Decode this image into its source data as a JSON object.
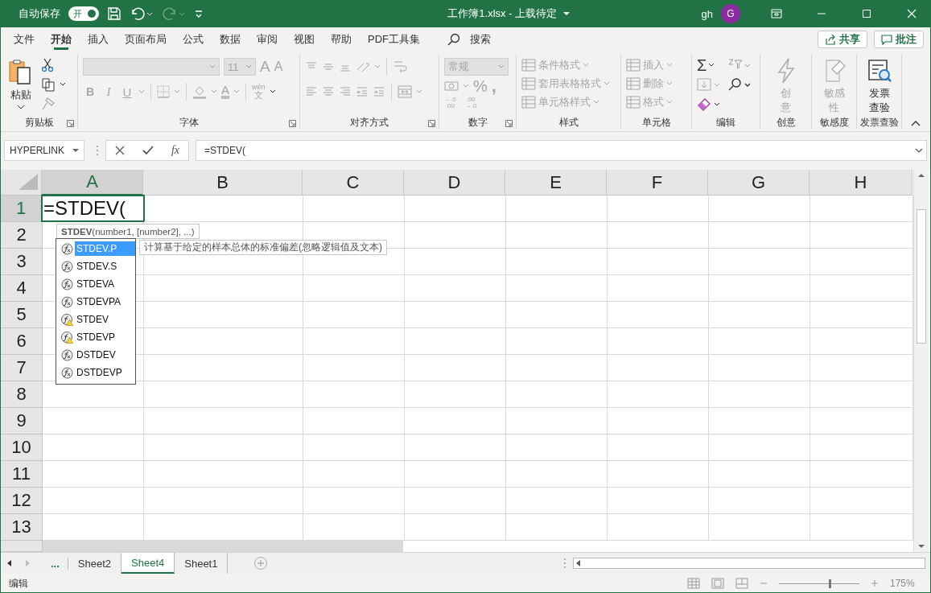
{
  "title_bar": {
    "autosave_label": "自动保存",
    "autosave": {
      "label": "开",
      "on": true
    },
    "title": "工作簿1.xlsx - 上载待定",
    "user": "gh",
    "avatar": "G"
  },
  "menu_tabs": [
    {
      "label": "文件",
      "selected": false
    },
    {
      "label": "开始",
      "selected": true
    },
    {
      "label": "插入",
      "selected": false
    },
    {
      "label": "页面布局",
      "selected": false
    },
    {
      "label": "公式",
      "selected": false
    },
    {
      "label": "数据",
      "selected": false
    },
    {
      "label": "审阅",
      "selected": false
    },
    {
      "label": "视图",
      "selected": false
    },
    {
      "label": "帮助",
      "selected": false
    },
    {
      "label": "PDF工具集",
      "selected": false
    }
  ],
  "search": {
    "label": "搜索"
  },
  "share_button": "共享",
  "comments_button": "批注",
  "ribbon": [
    {
      "kind": "clipboard",
      "label": "剪贴板",
      "paste": "粘贴",
      "launcher": true
    },
    {
      "kind": "font",
      "label": "字体",
      "disabled": true,
      "size": "11",
      "grow": "A",
      "shrink": "A",
      "bold": "B",
      "italic": "I",
      "underline": "U",
      "font_color": "A",
      "phonetic_top": "wén",
      "phonetic_bottom": "文",
      "launcher": true
    },
    {
      "kind": "alignment",
      "label": "对齐方式",
      "disabled": true,
      "launcher": true
    },
    {
      "kind": "number",
      "label": "数字",
      "disabled": true,
      "format": "常规",
      "percent": "%",
      "comma": ",",
      "inc_decimal": [
        "←.0",
        ".00"
      ],
      "dec_decimal": [
        ".00",
        "→.0"
      ],
      "launcher": true
    },
    {
      "kind": "styles",
      "label": "样式",
      "disabled": true,
      "items": [
        "条件格式",
        "套用表格格式",
        "单元格样式"
      ]
    },
    {
      "kind": "cells",
      "label": "单元格",
      "disabled": true,
      "items": [
        "插入",
        "删除",
        "格式"
      ]
    },
    {
      "kind": "editing",
      "label": "编辑",
      "sum": "Σ"
    },
    {
      "kind": "creativity",
      "label": "创意",
      "button": "创意",
      "disabled": true
    },
    {
      "kind": "sensitivity",
      "label": "敏感度",
      "button": "敏感性",
      "disabled": true
    },
    {
      "kind": "invoice",
      "label": "发票查验",
      "button": "发票查验",
      "disabled": false
    }
  ],
  "formula_bar": {
    "name_box": "HYPERLINK",
    "insert_function": "fx",
    "formula": "=STDEV("
  },
  "sheet": {
    "columns": [
      {
        "label": "A",
        "selected": true
      },
      {
        "label": "B",
        "selected": false
      },
      {
        "label": "C",
        "selected": false
      },
      {
        "label": "D",
        "selected": false
      },
      {
        "label": "E",
        "selected": false
      },
      {
        "label": "F",
        "selected": false
      },
      {
        "label": "G",
        "selected": false
      },
      {
        "label": "H",
        "selected": false
      }
    ],
    "rows": [
      {
        "label": "1",
        "selected": true
      },
      {
        "label": "2",
        "selected": false
      },
      {
        "label": "3",
        "selected": false
      },
      {
        "label": "4",
        "selected": false
      },
      {
        "label": "5",
        "selected": false
      },
      {
        "label": "6",
        "selected": false
      },
      {
        "label": "7",
        "selected": false
      },
      {
        "label": "8",
        "selected": false
      },
      {
        "label": "9",
        "selected": false
      },
      {
        "label": "10",
        "selected": false
      },
      {
        "label": "11",
        "selected": false
      },
      {
        "label": "12",
        "selected": false
      },
      {
        "label": "13",
        "selected": false
      }
    ],
    "active_cell": "=STDEV(",
    "arg_tooltip": "**STDEV**(number1, [number2], ...)",
    "autocomplete": [
      {
        "name": "STDEV.P",
        "kind": "function",
        "selected": true
      },
      {
        "name": "STDEV.S",
        "kind": "function",
        "selected": false
      },
      {
        "name": "STDEVA",
        "kind": "function",
        "selected": false
      },
      {
        "name": "STDEVPA",
        "kind": "function",
        "selected": false
      },
      {
        "name": "STDEV",
        "kind": "compat",
        "selected": false
      },
      {
        "name": "STDEVP",
        "kind": "compat",
        "selected": false
      },
      {
        "name": "DSTDEV",
        "kind": "function",
        "selected": false
      },
      {
        "name": "DSTDEVP",
        "kind": "function",
        "selected": false
      }
    ],
    "description": "计算基于给定的样本总体的标准偏差(忽略逻辑值及文本)"
  },
  "sheet_tabs": {
    "more": "...",
    "tabs": [
      {
        "label": "Sheet2",
        "selected": false
      },
      {
        "label": "Sheet4",
        "selected": true
      },
      {
        "label": "Sheet1",
        "selected": false
      }
    ]
  },
  "status_bar": {
    "mode": "编辑",
    "zoom": "175%",
    "zoom_slider": {
      "level": 0.62
    }
  }
}
